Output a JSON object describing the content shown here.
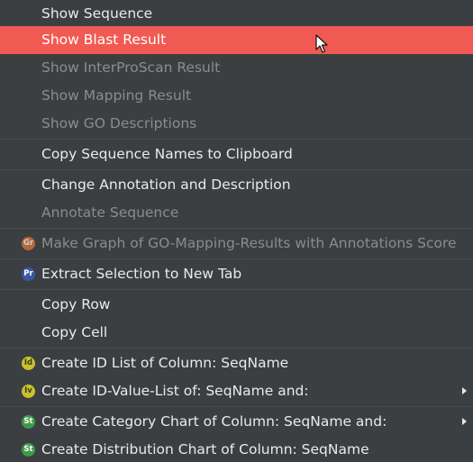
{
  "menu": {
    "items": [
      {
        "label": "Show Sequence"
      },
      {
        "label": "Show Blast Result"
      },
      {
        "label": "Show InterProScan Result"
      },
      {
        "label": "Show Mapping Result"
      },
      {
        "label": "Show GO Descriptions"
      },
      {
        "label": "Copy Sequence Names to Clipboard"
      },
      {
        "label": "Change Annotation and Description"
      },
      {
        "label": "Annotate Sequence"
      },
      {
        "label": "Make Graph of GO-Mapping-Results with Annotations Score",
        "badge": "Gr"
      },
      {
        "label": "Extract Selection to New Tab",
        "badge": "Pr"
      },
      {
        "label": "Copy Row"
      },
      {
        "label": "Copy Cell"
      },
      {
        "label": "Create ID List of Column: SeqName",
        "badge": "Id"
      },
      {
        "label": "Create ID-Value-List of: SeqName and:",
        "badge": "Iv"
      },
      {
        "label": "Create Category Chart of Column: SeqName and:",
        "badge": "St"
      },
      {
        "label": "Create Distribution Chart of Column: SeqName",
        "badge": "St"
      }
    ]
  },
  "colors": {
    "background": "#3c3f41",
    "highlight": "#f05a52",
    "text": "#eaeaea",
    "disabled_text": "#8a8c8e",
    "badge_gr": "#d9773a",
    "badge_pr": "#3b57a6",
    "badge_id": "#c9c12c",
    "badge_st": "#3f9a4a"
  },
  "icons": {
    "submenu": "chevron-right-icon",
    "cursor": "mouse-pointer-icon"
  }
}
